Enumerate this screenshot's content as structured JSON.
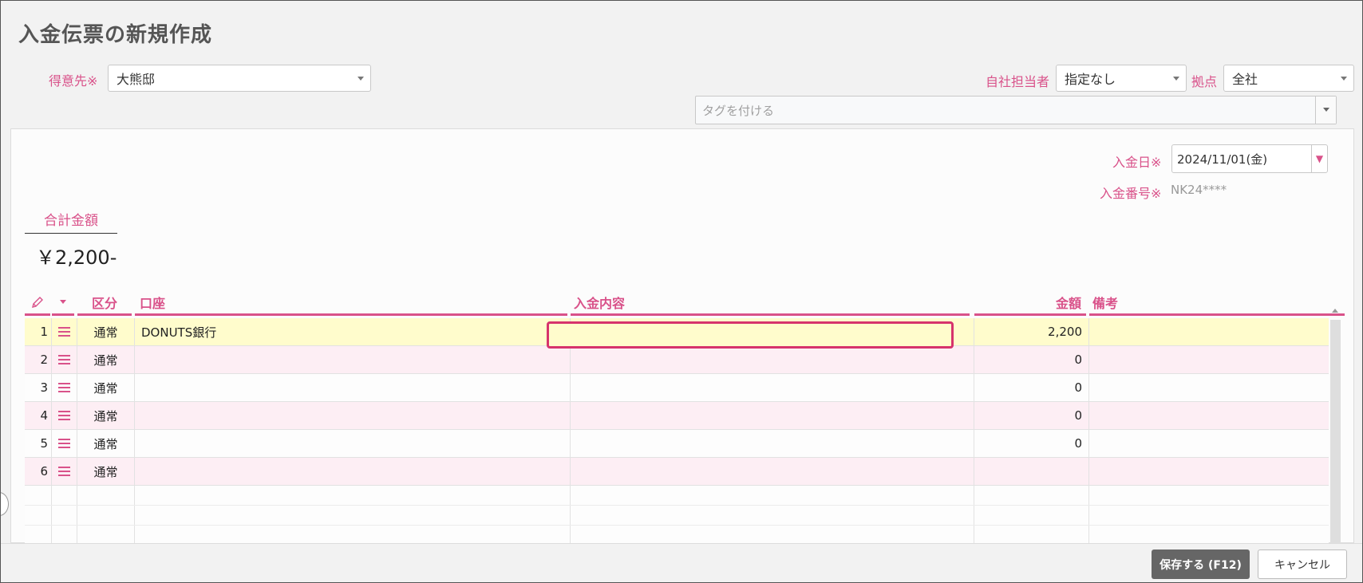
{
  "page": {
    "title": "入金伝票の新規作成"
  },
  "customer": {
    "label": "得意先※",
    "value": "大熊邸"
  },
  "staff": {
    "label": "自社担当者",
    "value": "指定なし"
  },
  "branch": {
    "label": "拠点",
    "value": "全社"
  },
  "tags": {
    "placeholder": "タグを付ける"
  },
  "payment_date": {
    "label": "入金日※",
    "value": "2024/11/01(金)"
  },
  "payment_number": {
    "label": "入金番号※",
    "value": "NK24****"
  },
  "total": {
    "label": "合計金額",
    "value": "￥2,200-"
  },
  "grid": {
    "headers": {
      "kubun": "区分",
      "account": "口座",
      "content": "入金内容",
      "amount": "金額",
      "note": "備考"
    },
    "rows": [
      {
        "no": "1",
        "kubun": "通常",
        "account": "DONUTS銀行",
        "content": "",
        "amount": "2,200",
        "note": ""
      },
      {
        "no": "2",
        "kubun": "通常",
        "account": "",
        "content": "",
        "amount": "0",
        "note": ""
      },
      {
        "no": "3",
        "kubun": "通常",
        "account": "",
        "content": "",
        "amount": "0",
        "note": ""
      },
      {
        "no": "4",
        "kubun": "通常",
        "account": "",
        "content": "",
        "amount": "0",
        "note": ""
      },
      {
        "no": "5",
        "kubun": "通常",
        "account": "",
        "content": "",
        "amount": "0",
        "note": ""
      },
      {
        "no": "6",
        "kubun": "通常",
        "account": "",
        "content": "",
        "amount": "",
        "note": ""
      }
    ]
  },
  "footer": {
    "save_label": "保存する (F12)",
    "cancel_label": "キャンセル"
  },
  "colors": {
    "accent": "#d9528a",
    "edit_border": "#d6336c",
    "row_highlight": "#fffccc",
    "row_alt": "#fdeef4"
  }
}
